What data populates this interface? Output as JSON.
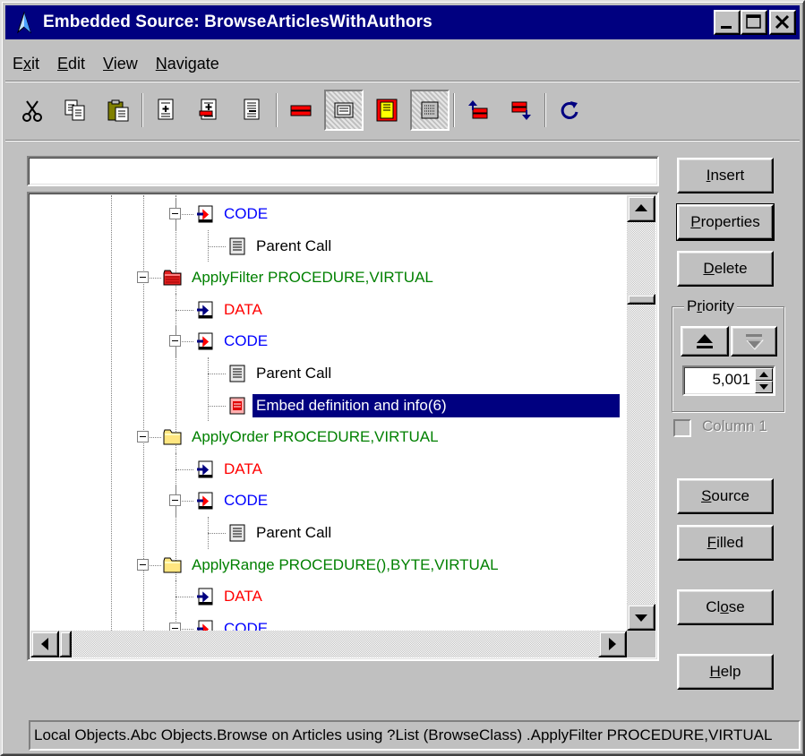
{
  "window": {
    "title": "Embedded Source: BrowseArticlesWithAuthors"
  },
  "menu": [
    {
      "label": "Exit",
      "accel": "x"
    },
    {
      "label": "Edit",
      "accel": "E"
    },
    {
      "label": "View",
      "accel": "V"
    },
    {
      "label": "Navigate",
      "accel": "N"
    }
  ],
  "toolbar": {
    "tools": [
      "cut-icon",
      "copy-icon",
      "paste-icon",
      "insert-embed-icon",
      "insert-embed-before-icon",
      "insert-embed-after-icon",
      "delete-embed-icon",
      "view-code-icon",
      "filled-only-icon",
      "show-all-icon",
      "previous-embed-icon",
      "next-embed-icon",
      "refresh-icon"
    ],
    "pressed": [
      "view-code-icon",
      "show-all-icon"
    ]
  },
  "search": {
    "value": ""
  },
  "tree": [
    {
      "type": "code",
      "label": "CODE",
      "color": "blue"
    },
    {
      "type": "parent",
      "label": "Parent Call",
      "color": "black"
    },
    {
      "type": "proc",
      "label": "ApplyFilter PROCEDURE,VIRTUAL",
      "color": "green",
      "folder": "red"
    },
    {
      "type": "data",
      "label": "DATA",
      "color": "red"
    },
    {
      "type": "code",
      "label": "CODE",
      "color": "blue"
    },
    {
      "type": "parent",
      "label": "Parent Call",
      "color": "black"
    },
    {
      "type": "embed",
      "label": "Embed definition and info(6)",
      "color": "black",
      "selected": true
    },
    {
      "type": "proc",
      "label": "ApplyOrder PROCEDURE,VIRTUAL",
      "color": "green",
      "folder": "yellow"
    },
    {
      "type": "data",
      "label": "DATA",
      "color": "red"
    },
    {
      "type": "code",
      "label": "CODE",
      "color": "blue"
    },
    {
      "type": "parent",
      "label": "Parent Call",
      "color": "black"
    },
    {
      "type": "proc",
      "label": "ApplyRange PROCEDURE(),BYTE,VIRTUAL",
      "color": "green",
      "folder": "yellow"
    },
    {
      "type": "data",
      "label": "DATA",
      "color": "red"
    },
    {
      "type": "code",
      "label": "CODE",
      "color": "blue"
    }
  ],
  "buttons": {
    "insert": {
      "pre": "",
      "ul": "I",
      "post": "nsert"
    },
    "properties": {
      "pre": "",
      "ul": "P",
      "post": "roperties"
    },
    "delete": {
      "pre": "",
      "ul": "D",
      "post": "elete"
    },
    "source": {
      "pre": "",
      "ul": "S",
      "post": "ource"
    },
    "filled": {
      "pre": "",
      "ul": "F",
      "post": "illed"
    },
    "close": {
      "pre": "Cl",
      "ul": "o",
      "post": "se"
    },
    "help": {
      "pre": "",
      "ul": "H",
      "post": "elp"
    }
  },
  "priority": {
    "label_pre": "P",
    "label_ul": "r",
    "label_post": "iority",
    "value": "5,001"
  },
  "column": {
    "label": "Column 1",
    "checked": false
  },
  "status": "Local Objects.Abc Objects.Browse on Articles using ?List (BrowseClass) .ApplyFilter PROCEDURE,VIRTUAL"
}
